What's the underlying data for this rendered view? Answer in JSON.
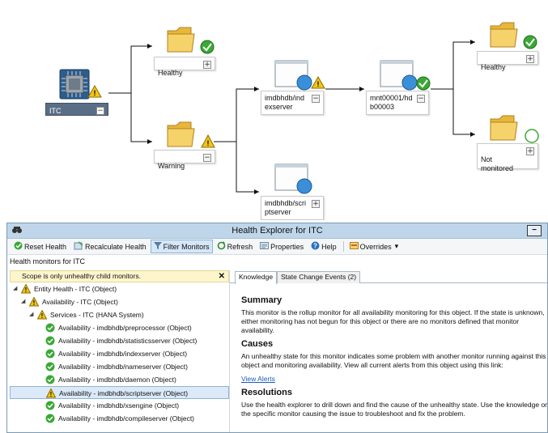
{
  "diagram": {
    "nodes": {
      "itc": {
        "label": "ITC",
        "toggle": "−"
      },
      "healthy_folder": {
        "label": "Healthy",
        "toggle": "+"
      },
      "warning_folder": {
        "label": "Warning",
        "toggle": "−"
      },
      "indexserver": {
        "label": "imdbhdb/indexserver",
        "toggle": "−"
      },
      "scriptserver": {
        "label": "imdbhdb/scriptserver",
        "toggle": "+"
      },
      "mnt00001": {
        "label": "mnt00001/hdb00003",
        "toggle": "−"
      },
      "healthy_right": {
        "label": "Healthy",
        "toggle": "+"
      },
      "not_monitored": {
        "label": "Not\nmonitored",
        "toggle": "+"
      }
    }
  },
  "window": {
    "title": "Health Explorer for ITC",
    "minimize": "−",
    "toolbar": {
      "reset": "Reset Health",
      "recalc": "Recalculate Health",
      "filter": "Filter Monitors",
      "refresh": "Refresh",
      "properties": "Properties",
      "help": "Help",
      "overrides": "Overrides",
      "overrides_caret": "▾"
    },
    "subheader": "Health monitors for ITC",
    "filter_notice": "Scope is only unhealthy child monitors.",
    "filter_close": "✕",
    "tree": [
      {
        "label": "Entity Health - ITC (Object)",
        "status": "warning",
        "level": 0
      },
      {
        "label": "Availability - ITC (Object)",
        "status": "warning",
        "level": 1
      },
      {
        "label": "Services - ITC (HANA System)",
        "status": "warning",
        "level": 2
      },
      {
        "label": "Availability - imdbhdb/preprocessor (Object)",
        "status": "ok",
        "level": 3
      },
      {
        "label": "Availability - imdbhdb/statisticsserver (Object)",
        "status": "ok",
        "level": 3
      },
      {
        "label": "Availability - imdbhdb/indexserver (Object)",
        "status": "ok",
        "level": 3
      },
      {
        "label": "Availability - imdbhdb/nameserver (Object)",
        "status": "ok",
        "level": 3
      },
      {
        "label": "Availability - imdbhdb/daemon (Object)",
        "status": "ok",
        "level": 3
      },
      {
        "label": "Availability - imdbhdb/scriptserver (Object)",
        "status": "warning",
        "level": 3,
        "selected": true
      },
      {
        "label": "Availability - imdbhdb/xsengine (Object)",
        "status": "ok",
        "level": 3
      },
      {
        "label": "Availability - imdbhdb/compileserver (Object)",
        "status": "ok",
        "level": 3
      }
    ],
    "tabs": [
      "Knowledge",
      "State Change Events (2)"
    ],
    "knowledge": {
      "summary_title": "Summary",
      "summary_text": "This monitor is the rollup monitor for all availability monitoring for this object. If the state is unknown, either monitoring has not begun for this object or there are no monitors defined that monitor availability.",
      "causes_title": "Causes",
      "causes_text": "An unhealthy state for this monitor indicates some problem with another monitor running against this object and monitoring availability. View all current alerts from this object using this link:",
      "link": "View Alerts",
      "resolutions_title": "Resolutions",
      "resolutions_text": "Use the health explorer to drill down and find the cause of the unhealthy state. Use the knowledge on the specific monitor causing the issue to troubleshoot and fix the problem."
    }
  },
  "colors": {
    "ok": "#3aa935",
    "warning": "#f2c417",
    "accent": "#1a5fb4",
    "node_selected": "#5a6f86"
  }
}
